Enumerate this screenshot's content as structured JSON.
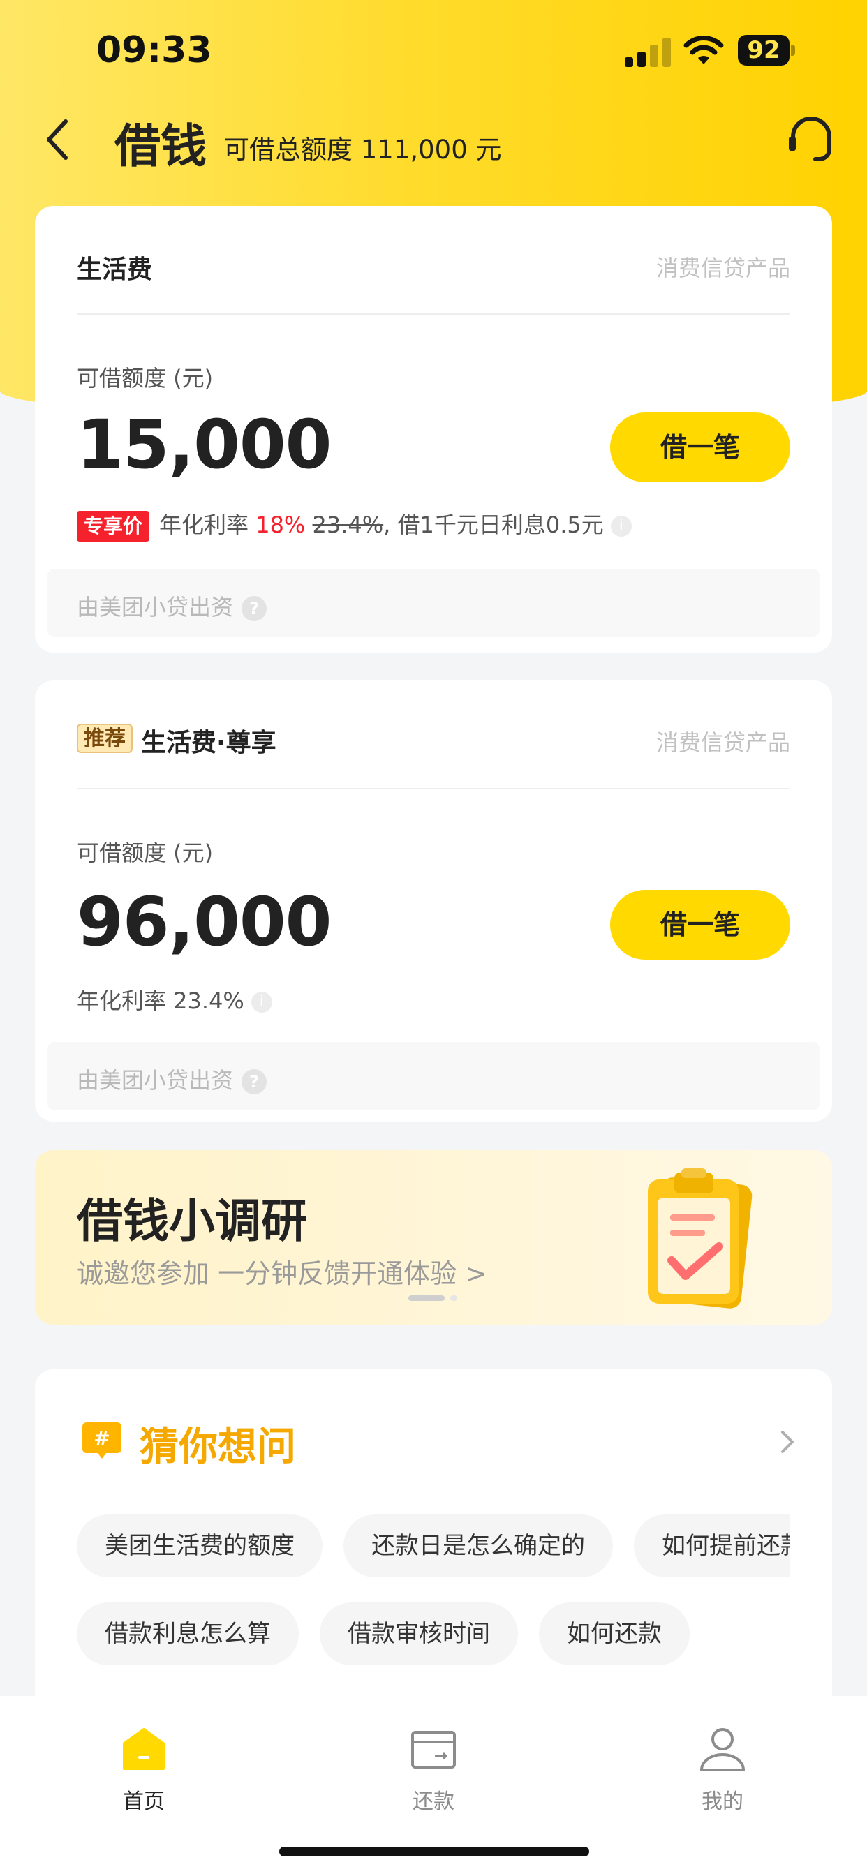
{
  "status_bar": {
    "time": "09:33",
    "battery": "92"
  },
  "nav": {
    "back_icon": "chevron-left-icon",
    "title": "借钱",
    "subtitle": "可借总额度 111,000 元",
    "support_icon": "headset-icon"
  },
  "cards": [
    {
      "title": "生活费",
      "category": "消费信贷产品",
      "limit_label": "可借额度 (元)",
      "limit_value": "15,000",
      "button": "借一笔",
      "badge": "专享价",
      "rate_prefix": "年化利率 ",
      "rate_discount": "18%",
      "rate_original": "23.4%",
      "rate_suffix": ", 借1千元日利息0.5元",
      "funder": "由美团小贷出资"
    },
    {
      "tag": "推荐",
      "title": "生活费·尊享",
      "category": "消费信贷产品",
      "limit_label": "可借额度 (元)",
      "limit_value": "96,000",
      "button": "借一笔",
      "rate": "年化利率 23.4%",
      "funder": "由美团小贷出资"
    }
  ],
  "banner": {
    "title": "借钱小调研",
    "subtitle": "诚邀您参加   一分钟反馈开通体验 >"
  },
  "faq": {
    "title": "猜你想问",
    "row1": [
      "美团生活费的额度",
      "还款日是怎么确定的",
      "如何提前还款"
    ],
    "row2": [
      "借款利息怎么算",
      "借款审核时间",
      "如何还款"
    ]
  },
  "tabbar": {
    "items": [
      {
        "label": "首页",
        "icon": "home-icon",
        "active": true
      },
      {
        "label": "还款",
        "icon": "wallet-icon",
        "active": false
      },
      {
        "label": "我的",
        "icon": "user-icon",
        "active": false
      }
    ]
  },
  "colors": {
    "brand_yellow": "#ffd900",
    "accent_red": "#f5222d",
    "faq_orange": "#f5a800"
  }
}
